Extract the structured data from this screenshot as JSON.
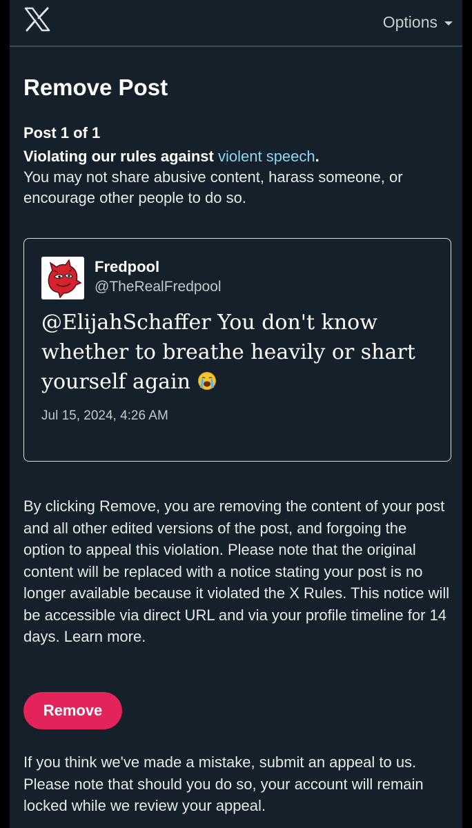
{
  "header": {
    "logo_icon": "x-logo-icon",
    "options_label": "Options"
  },
  "page": {
    "title": "Remove Post",
    "post_count": "Post 1 of 1",
    "violation_prefix": "Violating our rules against ",
    "violation_link": "violent speech",
    "violation_suffix": ".",
    "violation_description": "You may not share abusive content, harass someone, or encourage other people to do so."
  },
  "post": {
    "author_name": "Fredpool",
    "author_handle": "@TheRealFredpool",
    "text": "@ElijahSchaffer You don't know whether to breathe heavily or shart yourself again",
    "emoji_icon": "loudly-crying-face-icon",
    "timestamp": "Jul 15, 2024, 4:26 AM"
  },
  "explanation": {
    "text": "By clicking Remove, you are removing the content of your post and all other edited versions of the post, and forgoing the option to appeal this violation. Please note that the original content will be replaced with a notice stating your post is no longer available because it violated the X Rules. This notice will be accessible via direct URL and via your profile timeline for 14 days.",
    "learn_more": "Learn more."
  },
  "actions": {
    "remove_label": "Remove"
  },
  "appeal": {
    "text": "If you think we've made a mistake, submit an appeal to us. Please note that should you do so, your account will remain locked while we review your appeal."
  },
  "colors": {
    "background": "#15202b",
    "link": "#8bd7f5",
    "remove_button": "#e3235a",
    "text": "#e7e9ea"
  }
}
